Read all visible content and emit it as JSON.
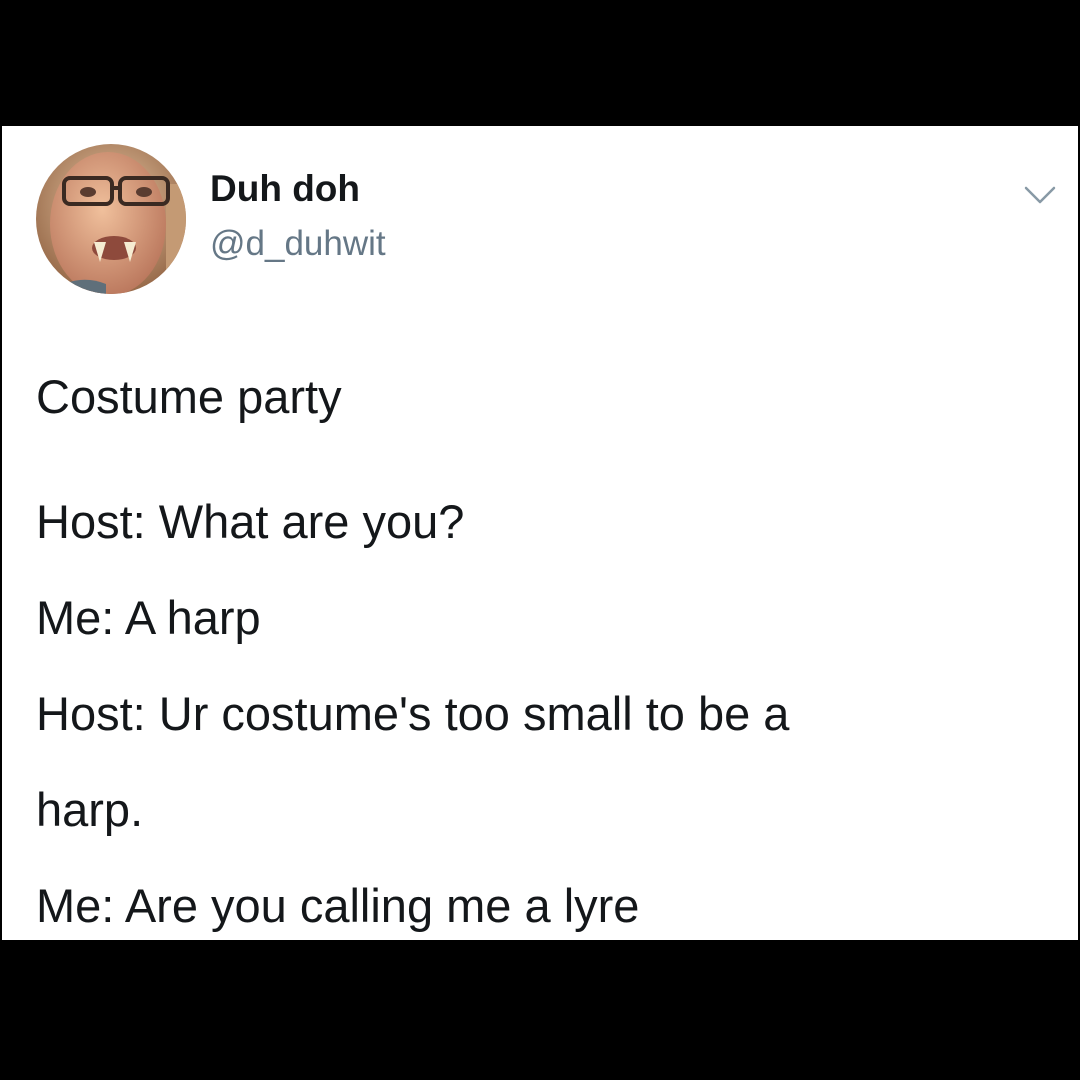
{
  "colors": {
    "frame_background": "#000000",
    "card_background": "#ffffff",
    "text_primary": "#14171a",
    "text_secondary": "#657786"
  },
  "tweet": {
    "author": {
      "display_name": "Duh doh",
      "handle": "@d_duhwit",
      "avatar_icon": "profile-photo"
    },
    "menu_icon": "chevron-down-icon",
    "text_lines": [
      "Costume party",
      "Host: What are you?",
      "Me: A harp",
      "Host: Ur costume's too small to be a",
      "harp.",
      "Me: Are you calling me a lyre"
    ]
  }
}
